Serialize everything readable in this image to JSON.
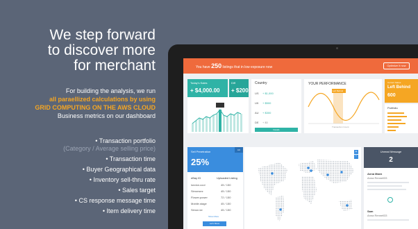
{
  "headline": [
    "We step forward",
    "to discover more",
    "for merchant"
  ],
  "intro": {
    "line1": "For building the analysis, we run",
    "line2": "all paraellized calculations by using",
    "line3": "GRID COMPUTING ON THE AWS CLOUD",
    "line4": "Business metrics on our dashboard"
  },
  "bullets": [
    "• Transaction portfolio",
    "(Category / Average selling price)",
    "• Transaction time",
    "• Buyer Geographical data",
    "• Inventory sell-thru rate",
    "• Sales target",
    "• CS response message time",
    "• Item delivery time"
  ],
  "dashboard": {
    "alert": {
      "prefix": "You have",
      "count": "250",
      "suffix": "listings that in low exposure now",
      "button": "Optimize it now"
    },
    "today": {
      "label": "Today's Sales",
      "value": "+ $4,000.00"
    },
    "diff": {
      "label": "Diff",
      "value": "+ $200"
    },
    "countries": {
      "header": "Country",
      "rows": [
        {
          "code": "US",
          "value": "+ $1,000"
        },
        {
          "code": "UK",
          "value": "+ $500"
        },
        {
          "code": "AU",
          "value": "+ $300"
        },
        {
          "code": "DE",
          "value": "+ $0"
        }
      ],
      "button": "Details"
    },
    "performance": {
      "title": "YOUR PERFORMANCE",
      "tag": "Left Behind",
      "axis": "Transaction Count"
    },
    "behind": {
      "label": "Current Status",
      "title": "Left Behind",
      "value": "600"
    },
    "portfolio": {
      "title": "Portfolio"
    },
    "penetration": {
      "label": "Sell Penetration",
      "value": "25%",
      "tag": "AU"
    },
    "table": {
      "col1": "eBay ID",
      "col2": "Uploaded Listing",
      "rows": [
        {
          "id": "london.cool",
          "val": "45 / 150"
        },
        {
          "id": "Simonsez",
          "val": "45 / 150"
        },
        {
          "id": "Flower.power",
          "val": "72 / 150"
        },
        {
          "id": "Mobile.stage",
          "val": "45 / 150"
        },
        {
          "id": "Simon.ke",
          "val": "45 / 150"
        }
      ],
      "more": "Show More",
      "button": "Let's Move"
    },
    "unread": {
      "label": "Unread Message",
      "count": "2"
    },
    "messages": [
      {
        "name": "Anna Maen",
        "user": "Anna Rennell33"
      },
      {
        "name": "Sam",
        "user": "Anna Rennell33"
      }
    ]
  }
}
